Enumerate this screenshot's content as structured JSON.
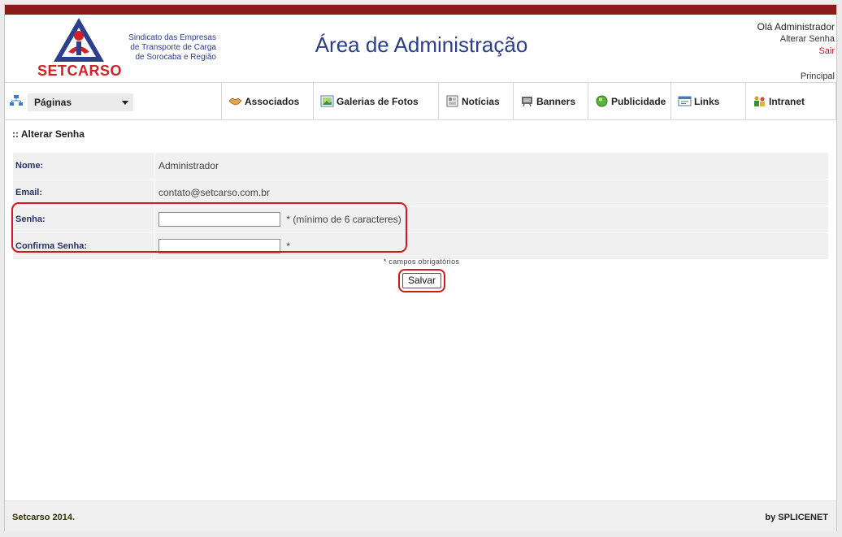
{
  "brand": {
    "logo_text": "SETCARSO",
    "subtitle_lines": [
      "Sindicato das Empresas",
      "de Transporte de Carga",
      "de Sorocaba e Região"
    ],
    "accent_red": "#d22027",
    "accent_blue": "#2b3f8a",
    "topbar_color": "#8b1b1b"
  },
  "header": {
    "title": "Área de Administração",
    "greeting": "Olá Administrador",
    "change_password_link": "Alterar Senha",
    "logout_link": "Sair",
    "principal_link": "Principal"
  },
  "menu": {
    "pages_label": "Páginas",
    "items": [
      {
        "label": "Associados",
        "icon": "handshake-icon"
      },
      {
        "label": "Galerias de Fotos",
        "icon": "photo-gallery-icon"
      },
      {
        "label": "Notícias",
        "icon": "news-icon"
      },
      {
        "label": "Banners",
        "icon": "banner-icon"
      },
      {
        "label": "Publicidade",
        "icon": "advertising-icon"
      },
      {
        "label": "Links",
        "icon": "links-icon"
      },
      {
        "label": "Intranet",
        "icon": "intranet-icon"
      }
    ]
  },
  "form": {
    "section_title": ":: Alterar Senha",
    "name_label": "Nome:",
    "name_value": "Administrador",
    "email_label": "Email:",
    "email_value": "contato@setcarso.com.br",
    "password_label": "Senha:",
    "password_value": "",
    "password_hint": "* (mínimo de 6 caracteres)",
    "confirm_label": "Confirma Senha:",
    "confirm_value": "",
    "confirm_hint": "*",
    "required_note": "* campos obrigatórios",
    "save_label": "Salvar"
  },
  "footer": {
    "left": "Setcarso 2014.",
    "right": "by SPLICENET"
  }
}
